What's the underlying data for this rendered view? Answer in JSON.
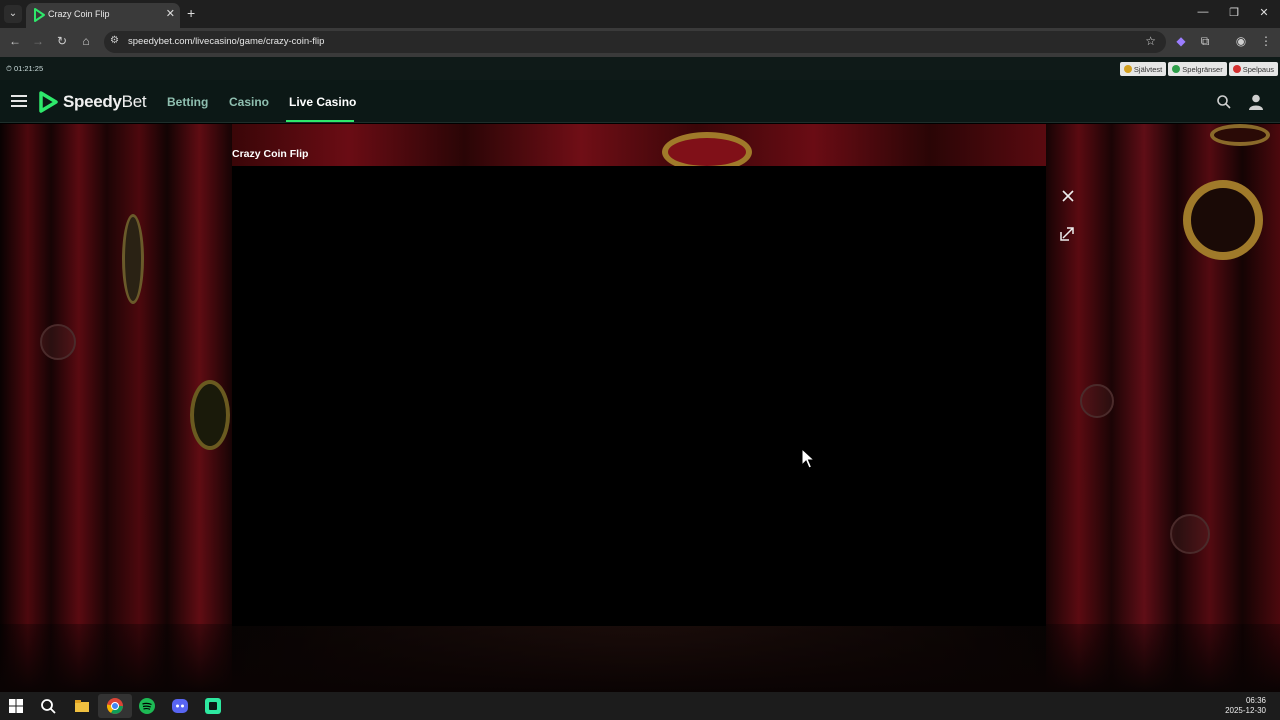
{
  "browser": {
    "tab_title": "Crazy Coin Flip",
    "url": "speedybet.com/livecasino/game/crazy-coin-flip",
    "window_controls": [
      "minimize-icon",
      "restore-icon",
      "close-icon"
    ]
  },
  "site": {
    "timer": "01:21:25",
    "responsible_gaming": [
      {
        "label": "Självtest",
        "color": "#d4a020"
      },
      {
        "label": "Spelgränser",
        "color": "#2e9e4a"
      },
      {
        "label": "Spelpaus",
        "color": "#d32f2f"
      }
    ],
    "logo": {
      "speedy": "Speedy",
      "bet": "Bet",
      "accent": "#2ee86b"
    },
    "nav": [
      {
        "label": "Betting"
      },
      {
        "label": "Casino"
      },
      {
        "label": "Live Casino",
        "active": true
      }
    ]
  },
  "game": {
    "title": "Crazy Coin Flip"
  },
  "taskbar": {
    "apps": [
      "windows-start-icon",
      "search-icon",
      "file-explorer-icon",
      "chrome-icon",
      "spotify-icon",
      "discord-icon",
      "app-icon"
    ],
    "time": "06:36",
    "date": "2025-12-30"
  }
}
